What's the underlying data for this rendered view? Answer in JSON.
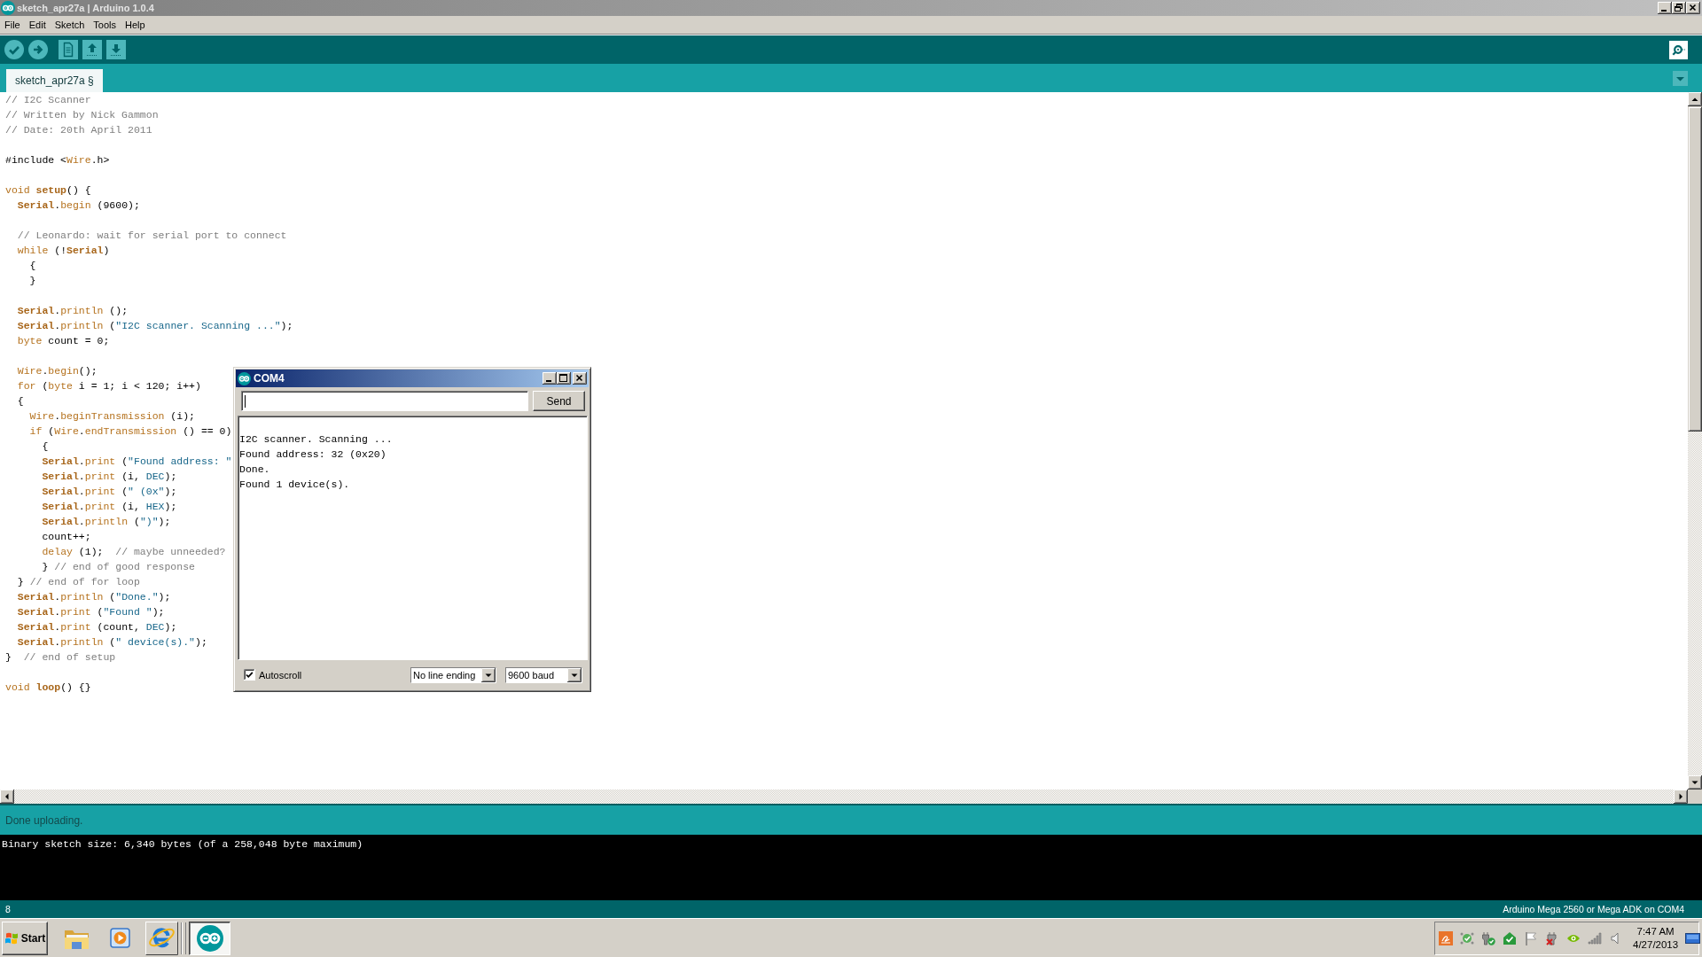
{
  "window": {
    "title": "sketch_apr27a | Arduino 1.0.4",
    "active": false
  },
  "menu": [
    "File",
    "Edit",
    "Sketch",
    "Tools",
    "Help"
  ],
  "tabs": [
    {
      "label": "sketch_apr27a §",
      "selected": true
    }
  ],
  "editor": {
    "blocks": [
      [
        {
          "tokens": [
            {
              "text": "// I2C Scanner",
              "kind": "comment"
            }
          ]
        },
        {
          "tokens": [
            {
              "text": "// Written by Nick Gammon",
              "kind": "comment"
            }
          ]
        },
        {
          "tokens": [
            {
              "text": "// Date: 20th April 2011",
              "kind": "comment"
            }
          ]
        }
      ],
      [
        {
          "tokens": [
            {
              "text": "#include <",
              "kind": "plain"
            },
            {
              "text": "Wire",
              "kind": "keyword"
            },
            {
              "text": ".h>",
              "kind": "plain"
            }
          ]
        }
      ],
      [
        {
          "tokens": [
            {
              "text": "void ",
              "kind": "keyword"
            },
            {
              "text": "setup",
              "kind": "strong"
            },
            {
              "text": "() {",
              "kind": "plain"
            }
          ]
        },
        {
          "tokens": [
            {
              "text": "  Serial",
              "kind": "strong"
            },
            {
              "text": ".",
              "kind": "plain"
            },
            {
              "text": "begin",
              "kind": "keyword"
            },
            {
              "text": " (9600);",
              "kind": "plain"
            }
          ]
        }
      ],
      [
        {
          "tokens": [
            {
              "text": "  // Leonardo: wait for serial port to connect",
              "kind": "comment"
            }
          ]
        },
        {
          "tokens": [
            {
              "text": "  while",
              "kind": "keyword"
            },
            {
              "text": " (!",
              "kind": "plain"
            },
            {
              "text": "Serial",
              "kind": "strong"
            },
            {
              "text": ")",
              "kind": "plain"
            }
          ]
        },
        {
          "tokens": [
            {
              "text": "    {",
              "kind": "plain"
            }
          ]
        },
        {
          "tokens": [
            {
              "text": "    }",
              "kind": "plain"
            }
          ]
        }
      ],
      [
        {
          "tokens": [
            {
              "text": "  Serial",
              "kind": "strong"
            },
            {
              "text": ".",
              "kind": "plain"
            },
            {
              "text": "println",
              "kind": "keyword"
            },
            {
              "text": " ();",
              "kind": "plain"
            }
          ]
        },
        {
          "tokens": [
            {
              "text": "  Serial",
              "kind": "strong"
            },
            {
              "text": ".",
              "kind": "plain"
            },
            {
              "text": "println",
              "kind": "keyword"
            },
            {
              "text": " (",
              "kind": "plain"
            },
            {
              "text": "\"I2C scanner. Scanning ...\"",
              "kind": "literal"
            },
            {
              "text": ");",
              "kind": "plain"
            }
          ]
        },
        {
          "tokens": [
            {
              "text": "  byte",
              "kind": "keyword"
            },
            {
              "text": " count = 0;",
              "kind": "plain"
            }
          ]
        }
      ],
      [
        {
          "tokens": [
            {
              "text": "  Wire",
              "kind": "keyword"
            },
            {
              "text": ".",
              "kind": "plain"
            },
            {
              "text": "begin",
              "kind": "keyword"
            },
            {
              "text": "();",
              "kind": "plain"
            }
          ]
        },
        {
          "tokens": [
            {
              "text": "  for",
              "kind": "keyword"
            },
            {
              "text": " (",
              "kind": "plain"
            },
            {
              "text": "byte",
              "kind": "keyword"
            },
            {
              "text": " i = 1; i < 120; i++)",
              "kind": "plain"
            }
          ]
        },
        {
          "tokens": [
            {
              "text": "  {",
              "kind": "plain"
            }
          ]
        },
        {
          "tokens": [
            {
              "text": "    Wire",
              "kind": "keyword"
            },
            {
              "text": ".",
              "kind": "plain"
            },
            {
              "text": "beginTransmission",
              "kind": "keyword"
            },
            {
              "text": " (i);",
              "kind": "plain"
            }
          ]
        },
        {
          "tokens": [
            {
              "text": "    if",
              "kind": "keyword"
            },
            {
              "text": " (",
              "kind": "plain"
            },
            {
              "text": "Wire",
              "kind": "keyword"
            },
            {
              "text": ".",
              "kind": "plain"
            },
            {
              "text": "endTransmission",
              "kind": "keyword"
            },
            {
              "text": " () == 0)",
              "kind": "plain"
            }
          ]
        },
        {
          "tokens": [
            {
              "text": "      {",
              "kind": "plain"
            }
          ]
        },
        {
          "tokens": [
            {
              "text": "      Serial",
              "kind": "strong"
            },
            {
              "text": ".",
              "kind": "plain"
            },
            {
              "text": "print",
              "kind": "keyword"
            },
            {
              "text": " (",
              "kind": "plain"
            },
            {
              "text": "\"Found address: \"",
              "kind": "literal"
            }
          ]
        },
        {
          "tokens": [
            {
              "text": "      Serial",
              "kind": "strong"
            },
            {
              "text": ".",
              "kind": "plain"
            },
            {
              "text": "print",
              "kind": "keyword"
            },
            {
              "text": " (i, ",
              "kind": "plain"
            },
            {
              "text": "DEC",
              "kind": "literal"
            },
            {
              "text": ");",
              "kind": "plain"
            }
          ]
        },
        {
          "tokens": [
            {
              "text": "      Serial",
              "kind": "strong"
            },
            {
              "text": ".",
              "kind": "plain"
            },
            {
              "text": "print",
              "kind": "keyword"
            },
            {
              "text": " (",
              "kind": "plain"
            },
            {
              "text": "\" (0x\"",
              "kind": "literal"
            },
            {
              "text": ");",
              "kind": "plain"
            }
          ]
        },
        {
          "tokens": [
            {
              "text": "      Serial",
              "kind": "strong"
            },
            {
              "text": ".",
              "kind": "plain"
            },
            {
              "text": "print",
              "kind": "keyword"
            },
            {
              "text": " (i, ",
              "kind": "plain"
            },
            {
              "text": "HEX",
              "kind": "literal"
            },
            {
              "text": ");",
              "kind": "plain"
            }
          ]
        },
        {
          "tokens": [
            {
              "text": "      Serial",
              "kind": "strong"
            },
            {
              "text": ".",
              "kind": "plain"
            },
            {
              "text": "println",
              "kind": "keyword"
            },
            {
              "text": " (",
              "kind": "plain"
            },
            {
              "text": "\")\"",
              "kind": "literal"
            },
            {
              "text": ");",
              "kind": "plain"
            }
          ]
        },
        {
          "tokens": [
            {
              "text": "      count++;",
              "kind": "plain"
            }
          ]
        },
        {
          "tokens": [
            {
              "text": "      delay",
              "kind": "keyword"
            },
            {
              "text": " (1);  ",
              "kind": "plain"
            },
            {
              "text": "// maybe unneeded?",
              "kind": "comment"
            }
          ]
        },
        {
          "tokens": [
            {
              "text": "      } ",
              "kind": "plain"
            },
            {
              "text": "// end of good response",
              "kind": "comment"
            }
          ]
        },
        {
          "tokens": [
            {
              "text": "  } ",
              "kind": "plain"
            },
            {
              "text": "// end of for loop",
              "kind": "comment"
            }
          ]
        },
        {
          "tokens": [
            {
              "text": "  Serial",
              "kind": "strong"
            },
            {
              "text": ".",
              "kind": "plain"
            },
            {
              "text": "println",
              "kind": "keyword"
            },
            {
              "text": " (",
              "kind": "plain"
            },
            {
              "text": "\"Done.\"",
              "kind": "literal"
            },
            {
              "text": ");",
              "kind": "plain"
            }
          ]
        },
        {
          "tokens": [
            {
              "text": "  Serial",
              "kind": "strong"
            },
            {
              "text": ".",
              "kind": "plain"
            },
            {
              "text": "print",
              "kind": "keyword"
            },
            {
              "text": " (",
              "kind": "plain"
            },
            {
              "text": "\"Found \"",
              "kind": "literal"
            },
            {
              "text": ");",
              "kind": "plain"
            }
          ]
        },
        {
          "tokens": [
            {
              "text": "  Serial",
              "kind": "strong"
            },
            {
              "text": ".",
              "kind": "plain"
            },
            {
              "text": "print",
              "kind": "keyword"
            },
            {
              "text": " (count, ",
              "kind": "plain"
            },
            {
              "text": "DEC",
              "kind": "literal"
            },
            {
              "text": ");",
              "kind": "plain"
            }
          ]
        },
        {
          "tokens": [
            {
              "text": "  Serial",
              "kind": "strong"
            },
            {
              "text": ".",
              "kind": "plain"
            },
            {
              "text": "println",
              "kind": "keyword"
            },
            {
              "text": " (",
              "kind": "plain"
            },
            {
              "text": "\" device(s).\"",
              "kind": "literal"
            },
            {
              "text": ");",
              "kind": "plain"
            }
          ]
        },
        {
          "tokens": [
            {
              "text": "}  ",
              "kind": "plain"
            },
            {
              "text": "// end of setup",
              "kind": "comment"
            }
          ]
        }
      ],
      [
        {
          "tokens": [
            {
              "text": "void ",
              "kind": "keyword"
            },
            {
              "text": "loop",
              "kind": "strong"
            },
            {
              "text": "() {}",
              "kind": "plain"
            }
          ]
        }
      ]
    ]
  },
  "serial_monitor": {
    "title": "COM4",
    "active": true,
    "input": {
      "focused": true
    },
    "send_button": "Send",
    "output": [
      "I2C scanner. Scanning ...",
      "Found address: 32 (0x20)",
      "Done.",
      "Found 1 device(s)."
    ],
    "autoscroll": {
      "label": "Autoscroll",
      "checked": true
    },
    "line_ending": "No line ending",
    "baud_rate": "9600 baud"
  },
  "status": {
    "message": "Done uploading."
  },
  "console": {
    "lines": [
      "Binary sketch size: 6,340 bytes (of a 258,048 byte maximum)"
    ]
  },
  "footer": {
    "line_number": "8",
    "board": "Arduino Mega 2560 or Mega ADK on COM4"
  },
  "taskbar": {
    "start": "Start",
    "quick_launch": [
      {
        "kind": "folder",
        "highlighted": false
      },
      {
        "kind": "player",
        "highlighted": false
      },
      {
        "kind": "browser",
        "highlighted": true
      }
    ],
    "tasks": [
      {
        "kind": "arduino",
        "selected": true
      }
    ],
    "clock": {
      "time": "7:47 AM",
      "date": "4/27/2013"
    }
  }
}
